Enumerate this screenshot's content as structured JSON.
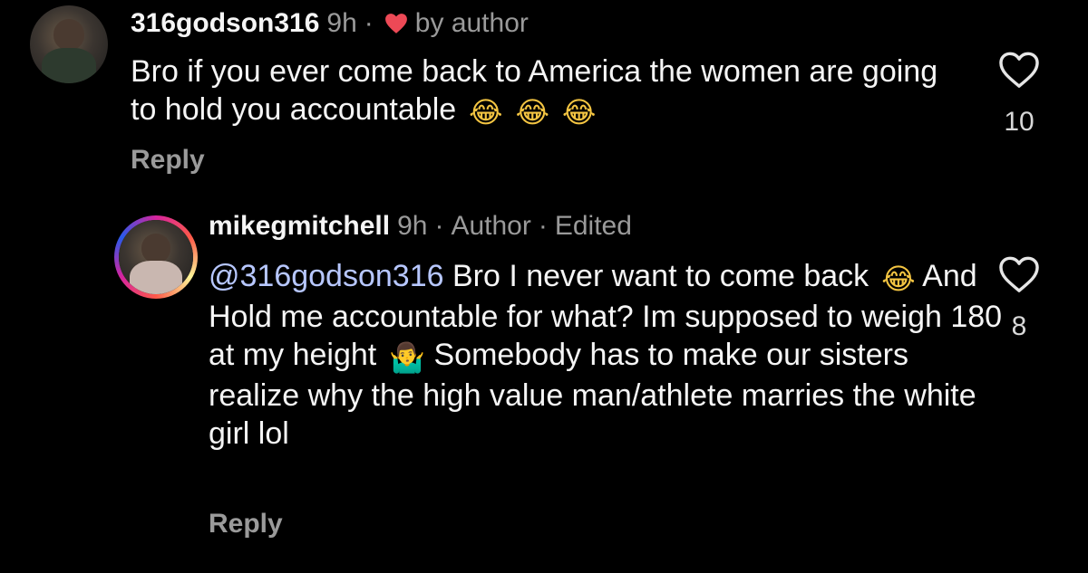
{
  "comments": [
    {
      "username": "316godson316",
      "time": "9h",
      "separator": "·",
      "by_author_label": "by author",
      "text": "Bro if you ever come back to America the women are going to hold you accountable",
      "emojis": [
        "😂",
        "😂",
        "😂"
      ],
      "reply_label": "Reply",
      "like_count": "10"
    },
    {
      "username": "mikegmitchell",
      "time": "9h",
      "separator": "·",
      "author_label": "Author",
      "edited_label": "Edited",
      "mention": "@316godson316",
      "text_part1": " Bro I never want to come back",
      "emoji1": "😂",
      "text_part2": " And Hold me accountable for what? Im supposed to weigh 180 at my height",
      "emoji2": "🤷‍♂️",
      "text_part3": " Somebody has to make our sisters realize why the high value man/athlete marries the white girl lol",
      "reply_label": "Reply",
      "like_count": "8"
    }
  ],
  "colors": {
    "background": "#000000",
    "text": "#f5f5f5",
    "muted": "#9a9a9a",
    "mention": "#b7c7ff",
    "heart_red": "#ed4956"
  },
  "icons": {
    "like": "heart-outline-icon",
    "liked_by_author": "heart-filled-icon"
  }
}
